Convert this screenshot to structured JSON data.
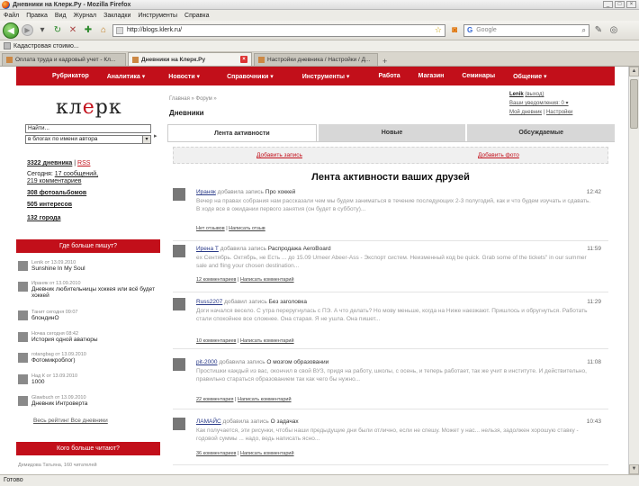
{
  "window": {
    "title": "Дневники на Клерк.Ру - Mozilla Firefox",
    "buttons": [
      "_",
      "□",
      "×"
    ]
  },
  "menu": [
    "Файл",
    "Правка",
    "Вид",
    "Журнал",
    "Закладки",
    "Инструменты",
    "Справка"
  ],
  "toolbar": {
    "url": "http://blogs.klerk.ru/",
    "search_placeholder": "Google",
    "search_engine": "G"
  },
  "bookmarks": [
    {
      "label": "Кадастровая стоимо..."
    }
  ],
  "tabs": [
    {
      "label": "Оплата труда и кадровый учет - Кл...",
      "active": false
    },
    {
      "label": "Дневники на Клерк.Ру",
      "active": true
    },
    {
      "label": "Настройки дневника / Настройки / Д...",
      "active": false
    }
  ],
  "sitenav": [
    "Рубрикатор",
    "Аналитика ▾",
    "Новости ▾",
    "Справочники ▾",
    "Инструменты ▾",
    "Работа",
    "Магазин",
    "Семинары",
    "Общение ▾"
  ],
  "logo": {
    "a": "кл",
    "b": "е",
    "c": "рк"
  },
  "search": {
    "placeholder": "Найти...",
    "scope": "в блогах по имени автора",
    "go": "▸"
  },
  "stats": {
    "diaries_count": "3322 дневника",
    "diaries_rss": "RSS",
    "today_prefix": "Сегодня:",
    "today_posts": "17 сообщений,",
    "today_comments": "219 комментариев",
    "albums": "308 фотоальбомов",
    "interests": "505 интересов",
    "cities": "132 города"
  },
  "who_writes": {
    "title": "Где больше пишут?",
    "items": [
      {
        "meta": "Lenik от 13.09.2010",
        "name": "Sunshine In My Soul"
      },
      {
        "meta": "Ираняк от 13.09.2010",
        "name": "Дневник любительницы хоккея или всё будет хоккей"
      },
      {
        "meta": "Танит сегодня 09:07",
        "name": "блондинО"
      },
      {
        "meta": "Ночка сегодня 08:42",
        "name": "История одной аватюры"
      },
      {
        "meta": "rotangbag от 13.09.2010",
        "name": "Фотомикроблог)"
      },
      {
        "meta": "Над К от 13.09.2010",
        "name": "1000"
      },
      {
        "meta": "Glawbuch от 13.09.2010",
        "name": "Дневник Интроверта"
      }
    ],
    "links": "Весь рейтинг Все дневники"
  },
  "who_reads": {
    "title": "Кого больше читают?",
    "first": "Демидова Татьяна, 160 читателей"
  },
  "breadcrumbs": "Главная » Форум »",
  "page_title": "Дневники",
  "user": {
    "name": "Lenik",
    "logout": "(выход)",
    "notifications": "Ваши уведомления: 0 ▾",
    "my_diary": "Мой дневник",
    "settings": "Настройки"
  },
  "content_tabs": [
    {
      "label": "Лента активности",
      "active": true
    },
    {
      "label": "Новые",
      "active": false
    },
    {
      "label": "Обсуждаемые",
      "active": false
    }
  ],
  "actions": {
    "add_post": "Добавить запись",
    "add_photo": "Добавить фото"
  },
  "feed_title": "Лента активности ваших друзей",
  "entries": [
    {
      "author": "Ираняк",
      "action": "добавила запись",
      "title": "Про хоккей",
      "time": "12:42",
      "text": "Вечер на правах собрания нам рассказали чем мы будем заниматься в течение последующих 2-3 полугодий, как и что будем изучать и сдавать. В ходе все в ожидании первого занятия (он будет в субботу)...",
      "links": [
        "Нет отзывов",
        "Написать отзыв"
      ]
    },
    {
      "author": "Ирена Т",
      "action": "добавила запись",
      "title": "Распродажа AeroBoard",
      "time": "11:59",
      "text": "ex Сентябрь. Октябрь, не Есть ... до 15.09 Umeer Abeer-Ass - Экспорт систем. Неизменный код be quick. Grab some of the tickets\" in our summer sale and fling your chosen destination...",
      "links": [
        "12 комментариев",
        "Написать комментарий"
      ]
    },
    {
      "author": "Russ2207",
      "action": "добавил запись",
      "title": "Без заголовка",
      "time": "11:29",
      "text": "Доги начался весело. С утра переругнулась с ПЭ. А что делать? Но мову меньше, когда на Ниже наезжают. Пришлось и обругнуться. Работать стали спокойнее все сложнее. Она старая. Я не ушла. Она пишет...",
      "links": [
        "10 комментариев",
        "Написать комментарий"
      ]
    },
    {
      "author": "pit-2000",
      "action": "добавила запись",
      "title": "О мозгом образовании",
      "time": "11:08",
      "text": "Простишки каждый из вас, окончил в свой ВУЗ, придя на работу, школы, с осень, и теперь работает, так же учит в институте. И действительно, правильно стараться образованием так как чего бы нужно...",
      "links": [
        "22 комментария",
        "Написать комментарий"
      ]
    },
    {
      "author": "ЛАМАЙС",
      "action": "добавила запись",
      "title": "О задачах",
      "time": "10:43",
      "text": "Как получается, эти рисунки, чтобы наши предыдущие дни были отлично, если не спешу. Может у нас... нельзя, задолжен хорошую ставку - годовой суммы ... надо, ведь написать ясно...",
      "links": [
        "36 комментариев",
        "Написать комментарий"
      ]
    }
  ],
  "status": "Готово",
  "colors": {
    "brand": "#c20f1a",
    "link": "#2a3a88"
  }
}
